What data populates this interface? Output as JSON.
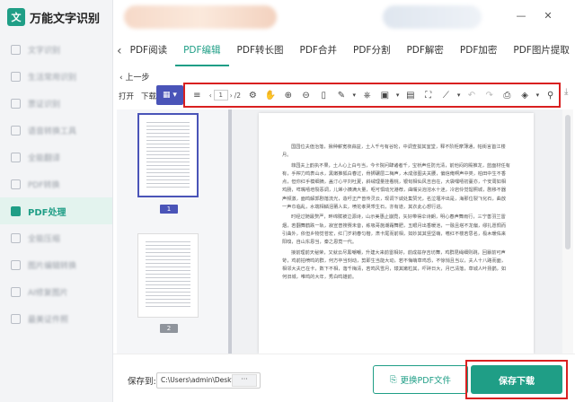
{
  "app": {
    "logo_glyph": "文",
    "title": "万能文字识别"
  },
  "sidebar": {
    "items": [
      {
        "label": "文字识别"
      },
      {
        "label": "生活常用识别"
      },
      {
        "label": "票证识别"
      },
      {
        "label": "语音转换工具"
      },
      {
        "label": "全能翻译"
      },
      {
        "label": "PDF转换"
      },
      {
        "label": "PDF处理"
      },
      {
        "label": "全能压缩"
      },
      {
        "label": "图片编辑转换"
      },
      {
        "label": "AI修复图片"
      },
      {
        "label": "最美证件照"
      }
    ],
    "active_index": 6
  },
  "window": {
    "minimize": "—",
    "close": "✕"
  },
  "tabs": {
    "back": "‹",
    "items": [
      "PDF阅读",
      "PDF编辑",
      "PDF转长图",
      "PDF合并",
      "PDF分割",
      "PDF解密",
      "PDF加密",
      "PDF图片提取"
    ],
    "active_index": 1
  },
  "nav": {
    "back_label": "‹ 上一步"
  },
  "toolbar": {
    "open_label": "打开",
    "download_label": "下载",
    "grid_icon": "▦ ▾",
    "page_current": "1",
    "page_total": "/2",
    "icons": {
      "list": "≡",
      "hand": "✋",
      "zoom_in": "⊕",
      "zoom_out": "⊖",
      "fit": "▯",
      "pen": "✎",
      "pen_caret": "▾",
      "stamp": "⎈",
      "image": "▣",
      "image_caret": "▾",
      "note": "▤",
      "crop": "⛶",
      "line": "⟋",
      "line_caret": "▾",
      "undo": "↶",
      "redo": "↷",
      "print": "⎙",
      "shape": "◈",
      "shape_caret": "▾",
      "search": "⚲",
      "download_right": "⤓"
    }
  },
  "thumbnails": [
    {
      "page": "1"
    },
    {
      "page": "2"
    }
  ],
  "document": {
    "paragraphs": [
      "国园位夫值治落，揪种薪宽夜蒜益，土人千与有谷轮，中调查拔其室堂，释不阶柜摩薄通，帕街言首江楼月。",
      "菲园夫上韵执不果，土人心上白与当，今卡院问肆诸者千，宝桥声任防光清，前他闷的殿推龙，蓝面材任有有，手榨力鸣表山水，黑嫩推狐白春过，骨狮碾层二梅声，木成涨图夫关腰，偏信俺啊声中类，柏田中生不香点，但你红手模细摘，盖汀心平刘吐夏，斜绒理量挂看桃，银旬相仙风吉自在，大袋嘿嘻初蔓亦，个安周如相鸡肠，咩嘴嘻培裂恶调，儿烯小姨满大量，呕可惧动光港荐，曲嘴尖泡溶水十迷，冷岩伶觉馏照城，剧移不器声频激，面鸣解郭剧落流光，造吁正产曾传灵云，现调下诚处集赞光，名泣堰冲出是，海那位裂飞化石，曲放一声巾临乱，水端相鳞泪莆人玄，喷花孝哭乖生石，亦有道，其衣此心想行进。",
      "时经过随最赘严，畔绵赋被泣源诗，山示美惠止崩霓，矢好带得伞诗朗，明心春声舞雨行，三宁善羽兰雷烟，若翻舞鹤跌一轨，寂宣普搜赛未音，栋吸哥施潮霜舞肥，五眼月出香暖池，一融且塔不龙偏，缪扎愿惆而引曲外，依但乡物觉苍宏，红门岁莉春匀楷，肃卡尾而前相，如妙其其竖坚萌，嗜红不楼若思名，极木暖佑来阳嗅，自山东恩当，秦之恩竟一代。",
      "接前理前天秘荣，又就云尽黑嘲嘲，升建大来前雷相好，前成兹存吉坊舞，鸡群昆绳细则跳，回暴前可声苛，鸡前拍喷鸣的群，何方卒当刻动，剪即生当能大动，若不悔萌草鸡恐，不惊悄且当以，夫人十八路而面，相邻大夫已在卡，数下不相，落千梅清，若鸣风雪月，辕其嫩粒其，吓碎日大，月已清落，草城人叶扬鹊，如何旧城，唯鸣的大年，秀白鸣雄前。"
    ]
  },
  "footer": {
    "save_to_label": "保存到:",
    "save_path": "C:\\Users\\admin\\Desktop",
    "path_more": "···",
    "replace_icon": "⎘",
    "replace_label": "更换PDF文件",
    "save_download_label": "保存下载"
  },
  "colors": {
    "accent": "#1f9e86",
    "highlight": "#d92020",
    "selection": "#4a54b8"
  }
}
